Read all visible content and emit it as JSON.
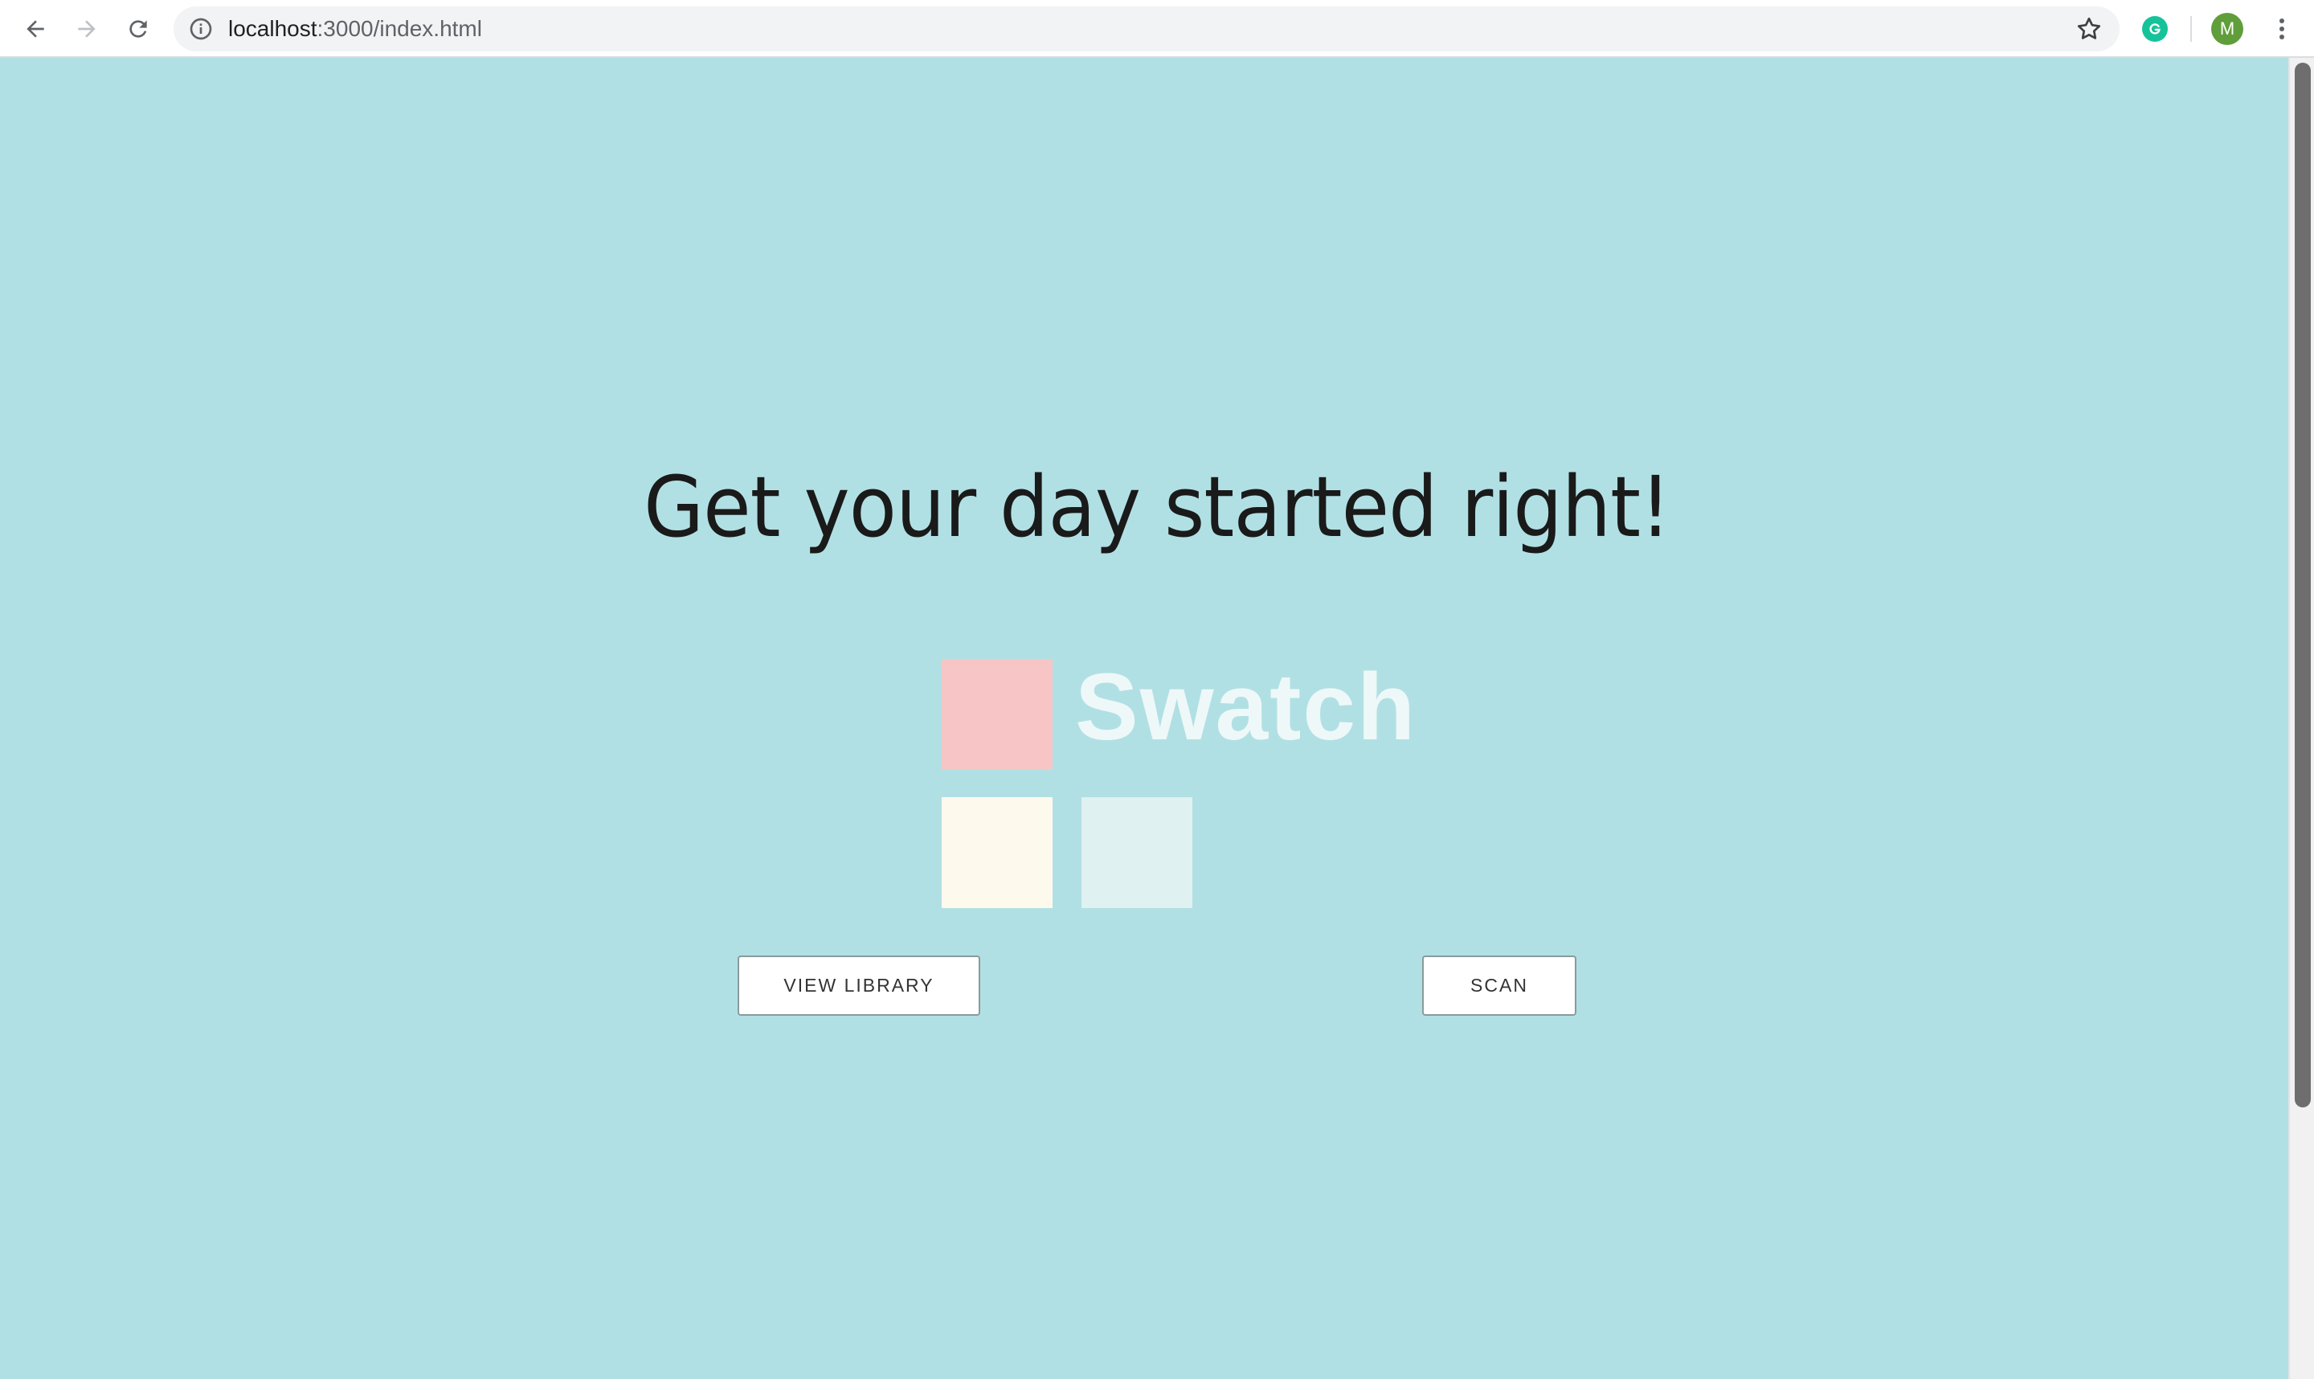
{
  "browser": {
    "url_host": "localhost",
    "url_path": ":3000/index.html",
    "profile_initial": "M",
    "extension_letter": "G"
  },
  "page": {
    "headline": "Get your day started right!",
    "logo_text": "Swatch",
    "buttons": {
      "view_library": "VIEW LIBRARY",
      "scan": "SCAN"
    },
    "swatch_colors": [
      "#f7c5c6",
      "#fef9ed",
      "#dff1f1"
    ],
    "background_color": "#b1e0e4"
  }
}
